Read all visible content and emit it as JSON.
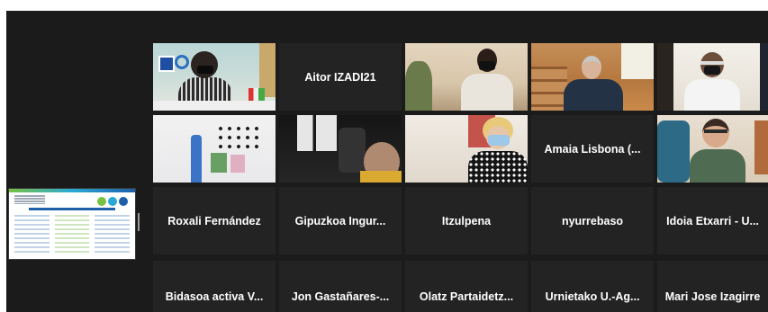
{
  "app": {
    "name": "Video meeting gallery view"
  },
  "shared_content": {
    "icon": "slide-thumbnail"
  },
  "colors": {
    "background": "#1b1b1b",
    "tile": "#232323",
    "active_speaker": "#c9e63c",
    "name_text": "#ffffff"
  },
  "participants": [
    {
      "name": "",
      "video": "office"
    },
    {
      "name": "Aitor IZADI21",
      "video": ""
    },
    {
      "name": "",
      "video": "room"
    },
    {
      "name": "",
      "video": "wood"
    },
    {
      "name": "",
      "video": "bright"
    },
    {
      "name": "",
      "video": "board"
    },
    {
      "name": "",
      "video": "dark"
    },
    {
      "name": "",
      "video": "headset"
    },
    {
      "name": "Amaia Lisbona (...",
      "video": ""
    },
    {
      "name": "",
      "video": "green"
    },
    {
      "name": "Roxali Fernández",
      "video": ""
    },
    {
      "name": "Gipuzkoa Ingur...",
      "video": ""
    },
    {
      "name": "Itzulpena",
      "video": ""
    },
    {
      "name": "nyurrebaso",
      "video": ""
    },
    {
      "name": "Idoia Etxarri - U...",
      "video": ""
    },
    {
      "name": "Bidasoa activa V...",
      "video": ""
    },
    {
      "name": "Jon Gastañares-...",
      "video": ""
    },
    {
      "name": "Olatz Partaidetz...",
      "video": ""
    },
    {
      "name": "Urnietako U.-Ag...",
      "video": ""
    },
    {
      "name": "Mari Jose Izagirre",
      "video": ""
    }
  ]
}
